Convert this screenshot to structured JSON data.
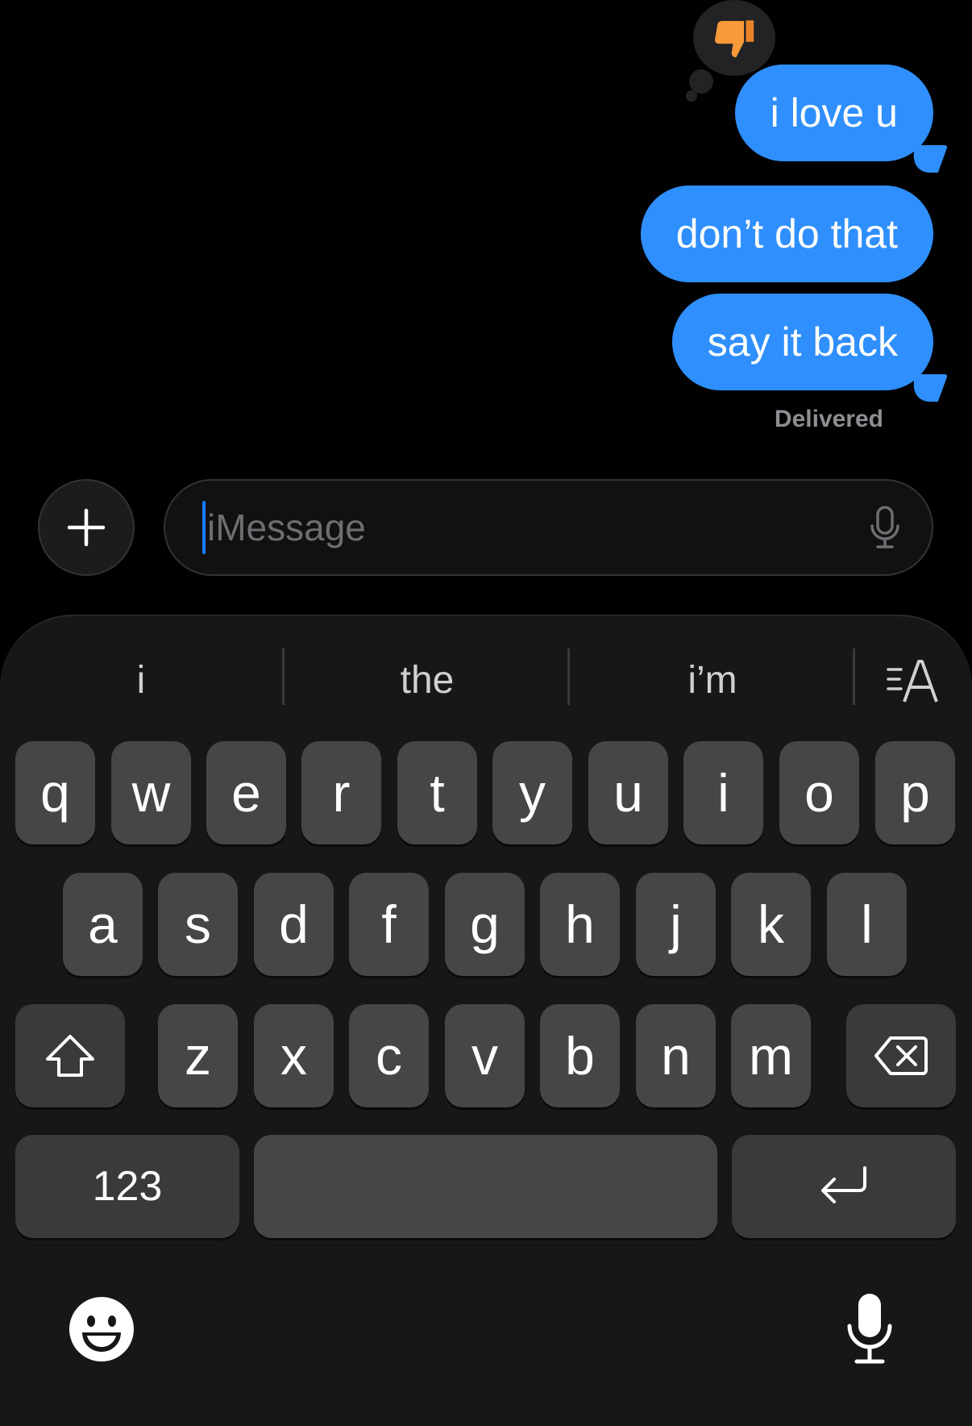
{
  "colors": {
    "bubble_blue": "#2f8fff",
    "background": "#000000",
    "keyboard_bg": "#171717",
    "key_bg": "#464648",
    "caret": "#1a7cff"
  },
  "conversation": {
    "reaction_icon": "thumbs-down-icon",
    "messages": [
      {
        "text": "i love u"
      },
      {
        "text": "don’t do that"
      },
      {
        "text": "say it back"
      }
    ],
    "status": "Delivered"
  },
  "composer": {
    "plus_icon": "plus-icon",
    "placeholder": "iMessage",
    "value": "",
    "mic_icon": "microphone-icon"
  },
  "keyboard": {
    "predictions": [
      "i",
      "the",
      "i’m"
    ],
    "text_format_icon": "text-format-icon",
    "row1": [
      "q",
      "w",
      "e",
      "r",
      "t",
      "y",
      "u",
      "i",
      "o",
      "p"
    ],
    "row2": [
      "a",
      "s",
      "d",
      "f",
      "g",
      "h",
      "j",
      "k",
      "l"
    ],
    "row3": [
      "z",
      "x",
      "c",
      "v",
      "b",
      "n",
      "m"
    ],
    "shift_icon": "shift-icon",
    "delete_icon": "delete-icon",
    "numbers_label": "123",
    "return_icon": "return-icon",
    "emoji_icon": "emoji-icon",
    "dictation_icon": "dictation-icon"
  }
}
